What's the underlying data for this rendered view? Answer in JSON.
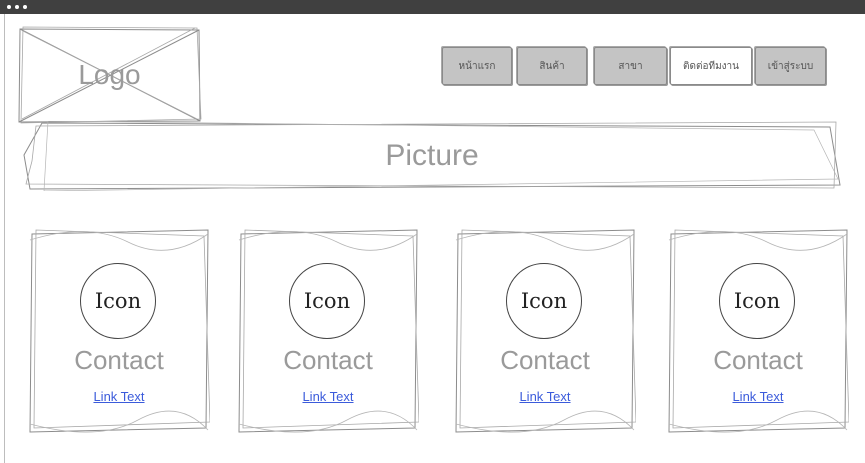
{
  "logo": {
    "label": "Logo"
  },
  "nav": {
    "items": [
      {
        "label": "หน้าแรก",
        "active": false
      },
      {
        "label": "สินค้า",
        "active": false
      },
      {
        "label": "สาขา",
        "active": false
      },
      {
        "label": "ติดต่อทีมงาน",
        "active": true
      },
      {
        "label": "เข้าสู่ระบบ",
        "active": false
      }
    ]
  },
  "hero": {
    "label": "Picture"
  },
  "cards": [
    {
      "icon": "Icon",
      "title": "Contact",
      "link": "Link Text"
    },
    {
      "icon": "Icon",
      "title": "Contact",
      "link": "Link Text"
    },
    {
      "icon": "Icon",
      "title": "Contact",
      "link": "Link Text"
    },
    {
      "icon": "Icon",
      "title": "Contact",
      "link": "Link Text"
    }
  ],
  "colors": {
    "topbar": "#404040",
    "nav_button": "#c4c4c4",
    "nav_button_active": "#ffffff",
    "placeholder_text": "#9a9a9a",
    "link": "#3b5bdb",
    "sketch_line": "#8c8c8c"
  }
}
